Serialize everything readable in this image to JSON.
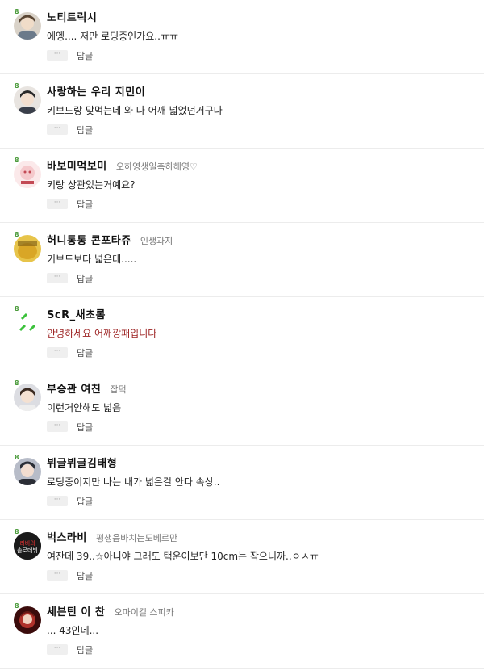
{
  "more_label": "···",
  "reply_label": "답글",
  "comments": [
    {
      "nick": "노티트릭시",
      "title": "",
      "text": "에엥.... 저만 로딩중인가요..ㅠㅠ",
      "text_color": "#222222",
      "level_badge": "8"
    },
    {
      "nick": "사랑하는 우리 지민이",
      "title": "",
      "text": "키보드랑 맞먹는데 와 나 어깨 넓었던거구나",
      "text_color": "#222222",
      "level_badge": "8"
    },
    {
      "nick": "바보미먹보미",
      "title": "오하영생일축하해영♡",
      "text": "키랑 상관있는거예요?",
      "text_color": "#222222",
      "level_badge": "8"
    },
    {
      "nick": "허니통통 콘포타쥬",
      "title": "인생과지",
      "text": "키보드보다 넓은데.....",
      "text_color": "#222222",
      "level_badge": "8"
    },
    {
      "nick": "ScR_새초롬",
      "title": "",
      "text": "안녕하세요 어깨깡패입니다",
      "text_color": "#9b1f1f",
      "level_badge": "8"
    },
    {
      "nick": "부승관 여친",
      "title": "잡덕",
      "text": "이런거안해도 넓음",
      "text_color": "#222222",
      "level_badge": "8"
    },
    {
      "nick": "뷔글뷔글김태형",
      "title": "",
      "text": "로딩중이지만 나는 내가 넓은걸 안다 속상..",
      "text_color": "#222222",
      "level_badge": "8"
    },
    {
      "nick": "벅스라비",
      "title": "평생음바치는도베르만",
      "text": "여잔데 39..☆아니야 그래도 택운이보단 10cm는 작으니까..ㅇㅅㅠ",
      "text_color": "#222222",
      "level_badge": "8",
      "avatar_text": "라비의 솔로데뷔"
    },
    {
      "nick": "세븐틴 이 찬",
      "title": "오마이걸 스피카",
      "text": "... 43인데...",
      "text_color": "#222222",
      "level_badge": "8"
    }
  ]
}
